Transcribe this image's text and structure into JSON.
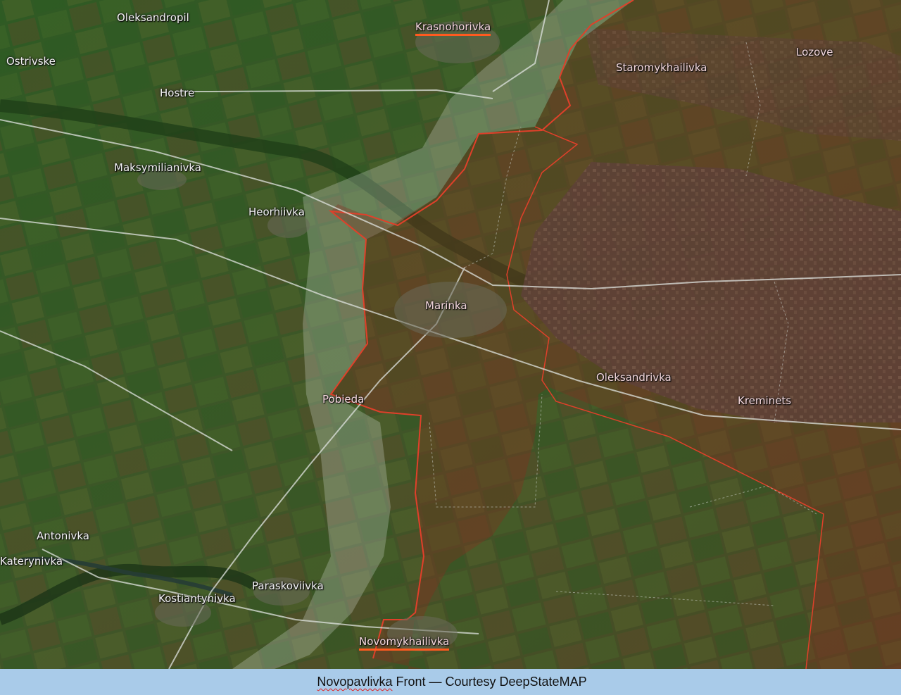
{
  "map": {
    "places": [
      {
        "id": "oleksandropil",
        "name": "Oleksandropil",
        "side": "ua"
      },
      {
        "id": "krasnohorivka",
        "name": "Krasnohorivka",
        "side": "ru",
        "highlighted": true
      },
      {
        "id": "ostrivske",
        "name": "Ostrivske",
        "side": "ua"
      },
      {
        "id": "hostre",
        "name": "Hostre",
        "side": "ua"
      },
      {
        "id": "staromykhailivka",
        "name": "Staromykhailivka",
        "side": "ru"
      },
      {
        "id": "lozove",
        "name": "Lozove",
        "side": "ru"
      },
      {
        "id": "maksymilianivka",
        "name": "Maksymilianivka",
        "side": "ua"
      },
      {
        "id": "heorhiivka",
        "name": "Heorhiivka",
        "side": "ua"
      },
      {
        "id": "marinka",
        "name": "Marinka",
        "side": "ru"
      },
      {
        "id": "oleksandrivka",
        "name": "Oleksandrivka",
        "side": "ru"
      },
      {
        "id": "kreminets",
        "name": "Kreminets",
        "side": "ru"
      },
      {
        "id": "pobieda",
        "name": "Pobieda",
        "side": "ru"
      },
      {
        "id": "antonivka",
        "name": "Antonivka",
        "side": "ua"
      },
      {
        "id": "katerynivka",
        "name": "Katerynivka",
        "side": "ua"
      },
      {
        "id": "paraskoviivka",
        "name": "Paraskoviivka",
        "side": "ua"
      },
      {
        "id": "kostiantynivka",
        "name": "Kostiantynivka",
        "side": "ua"
      },
      {
        "id": "novomykhailivka",
        "name": "Novomykhailivka",
        "side": "ru",
        "highlighted": true
      }
    ],
    "colors": {
      "occupied_fill": "#8a2a1f",
      "frontline": "#e0402a",
      "gray_zone": "#cfd8d0",
      "highlight_underline": "#ff5a1f",
      "caption_bar": "#a9cbe9"
    }
  },
  "caption": {
    "prefix": "Novopavlivka",
    "rest": " Front — Courtesy DeepStateMAP"
  }
}
